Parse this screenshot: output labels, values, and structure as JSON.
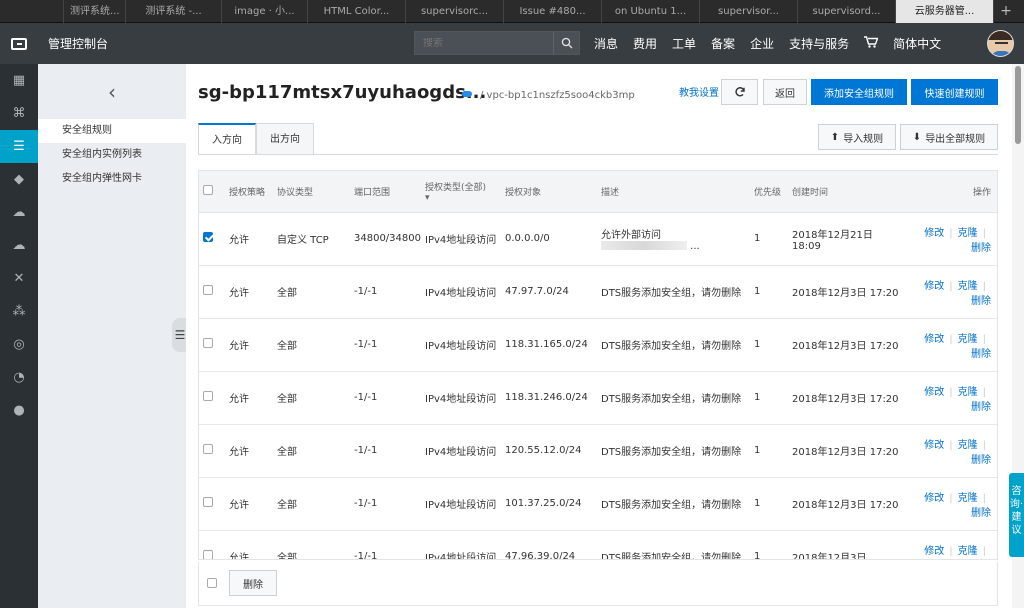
{
  "browser": {
    "tabs": [
      "",
      "测评系统...",
      "测评系统 -...",
      "image · 小...",
      "HTML Color...",
      "supervisorc...",
      "Issue #480...",
      "on Ubuntu 1...",
      "supervisor...",
      "supervisord...",
      "云服务器管..."
    ],
    "new_tab": "+"
  },
  "topnav": {
    "console_title": "管理控制台",
    "search_placeholder": "搜索",
    "links": [
      "消息",
      "费用",
      "工单",
      "备案",
      "企业",
      "支持与服务"
    ],
    "cart_icon": "cart-icon",
    "language": "简体中文"
  },
  "subnav": {
    "back_icon": "chevron-left-icon",
    "items": [
      "安全组规则",
      "安全组内实例列表",
      "安全组内弹性网卡"
    ]
  },
  "header": {
    "title": "sg-bp117mtsx7uyuhaogds...",
    "vpc": "/ vpc-bp1c1nszfz5soo4ckb3mp",
    "help_link": "教我设置",
    "back_btn": "返回",
    "add_btn": "添加安全组规则",
    "quick_btn": "快速创建规则",
    "import_btn": "导入规则",
    "export_btn": "导出全部规则"
  },
  "tabs": [
    "入方向",
    "出方向"
  ],
  "table": {
    "headers": [
      "授权策略",
      "协议类型",
      "端口范围",
      "授权类型(全部)",
      "授权对象",
      "描述",
      "优先级",
      "创建时间",
      "操作"
    ],
    "rows": [
      {
        "policy": "允许",
        "protocol": "自定义 TCP",
        "port": "34800/34800",
        "auth_type": "IPv4地址段访问",
        "target": "0.0.0.0/0",
        "desc": "允许外部访问",
        "priority": "1",
        "created": "2018年12月21日 18:09",
        "checked": true
      },
      {
        "policy": "允许",
        "protocol": "全部",
        "port": "-1/-1",
        "auth_type": "IPv4地址段访问",
        "target": "47.97.7.0/24",
        "desc": "DTS服务添加安全组，请勿删除",
        "priority": "1",
        "created": "2018年12月3日 17:20",
        "checked": false
      },
      {
        "policy": "允许",
        "protocol": "全部",
        "port": "-1/-1",
        "auth_type": "IPv4地址段访问",
        "target": "118.31.165.0/24",
        "desc": "DTS服务添加安全组，请勿删除",
        "priority": "1",
        "created": "2018年12月3日 17:20",
        "checked": false
      },
      {
        "policy": "允许",
        "protocol": "全部",
        "port": "-1/-1",
        "auth_type": "IPv4地址段访问",
        "target": "118.31.246.0/24",
        "desc": "DTS服务添加安全组，请勿删除",
        "priority": "1",
        "created": "2018年12月3日 17:20",
        "checked": false
      },
      {
        "policy": "允许",
        "protocol": "全部",
        "port": "-1/-1",
        "auth_type": "IPv4地址段访问",
        "target": "120.55.12.0/24",
        "desc": "DTS服务添加安全组，请勿删除",
        "priority": "1",
        "created": "2018年12月3日 17:20",
        "checked": false
      },
      {
        "policy": "允许",
        "protocol": "全部",
        "port": "-1/-1",
        "auth_type": "IPv4地址段访问",
        "target": "101.37.25.0/24",
        "desc": "DTS服务添加安全组，请勿删除",
        "priority": "1",
        "created": "2018年12月3日 17:20",
        "checked": false
      },
      {
        "policy": "允许",
        "protocol": "全部",
        "port": "-1/-1",
        "auth_type": "IPv4地址段访问",
        "target": "47.96.39.0/24",
        "desc": "DTS服务添加安全组，请勿删除",
        "priority": "1",
        "created": "2018年12月3日",
        "checked": false
      }
    ],
    "action_edit": "修改",
    "action_clone": "克隆",
    "action_delete": "删除"
  },
  "bottom": {
    "delete_btn": "删除"
  },
  "consult": "咨询·建议"
}
